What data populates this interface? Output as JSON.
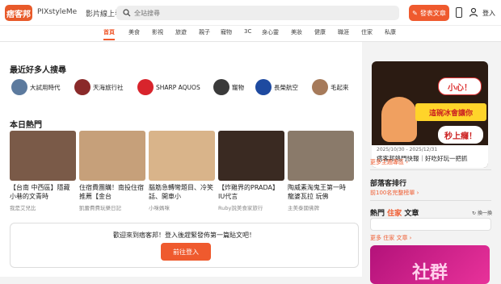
{
  "header": {
    "logo_text": "痞客邦",
    "brand_link": "PIXstyleMe",
    "video_link": "影片線上看",
    "search_placeholder": "全站搜尋",
    "write_button": "發表文章",
    "login": "登入"
  },
  "categories": [
    "首頁",
    "美食",
    "影視",
    "旅遊",
    "親子",
    "寵物",
    "3C",
    "身心靈",
    "美妝",
    "健康",
    "職涯",
    "住家",
    "私康"
  ],
  "popular_search": {
    "title": "最近好多人搜尋",
    "items": [
      {
        "label": "大試用時代",
        "color": "#5c7a9e"
      },
      {
        "label": "天海旅行社",
        "color": "#8a2a2a"
      },
      {
        "label": "SHARP AQUOS",
        "color": "#d8242c"
      },
      {
        "label": "寵物",
        "color": "#3a3a3a"
      },
      {
        "label": "長榮航空",
        "color": "#1e4aa0"
      },
      {
        "label": "毛起來",
        "color": "#a67a5a"
      }
    ]
  },
  "hot_today": {
    "title": "本日熱門",
    "cards": [
      {
        "title": "【台南 中西區】隱藏小巷的文青時",
        "author": "我是艾兒比",
        "color": "#7a5a48"
      },
      {
        "title": "住宿費團購！南投住宿推薦【金台",
        "author": "凱蕾費費玩樂日記",
        "color": "#c6a07a"
      },
      {
        "title": "腦筋急轉彎題目、冷笑話、開車小",
        "author": "小咪媽咪",
        "color": "#d9b48a"
      },
      {
        "title": "【炸雞界的PRADA】IU代言",
        "author": "Ruby說美食家旅行",
        "color": "#3a2a22"
      },
      {
        "title": "陶威素淘鬼王第一時 龍婆瓦拉 玩佛",
        "author": "主美泰國佛牌",
        "color": "#8a7a6a"
      }
    ]
  },
  "welcome": {
    "message": "歡迎來到痞客邦！登入後趕緊發佈第一篇貼文吧！",
    "login_button": "前往登入"
  },
  "sidebar": {
    "ad": {
      "bubble1": "小心！",
      "bubble2": "這碗冰會讓你",
      "bubble3": "秒上癮！",
      "date": "2025/10/30 - 2025/12/31",
      "promo": "痞客邦熱門快報｜好吃好玩一把抓"
    },
    "more_topics": "更多主題專區 ›",
    "blogger_rank_title": "部落客排行",
    "blogger_rank_link": "前100名完整榜單 ›",
    "hot_articles_title_pre": "熱門",
    "hot_articles_title_hl": "住家",
    "hot_articles_title_post": "文章",
    "refresh": "換一換",
    "more_articles": "更多 住家 文章 ›",
    "banner_text": "社群"
  }
}
